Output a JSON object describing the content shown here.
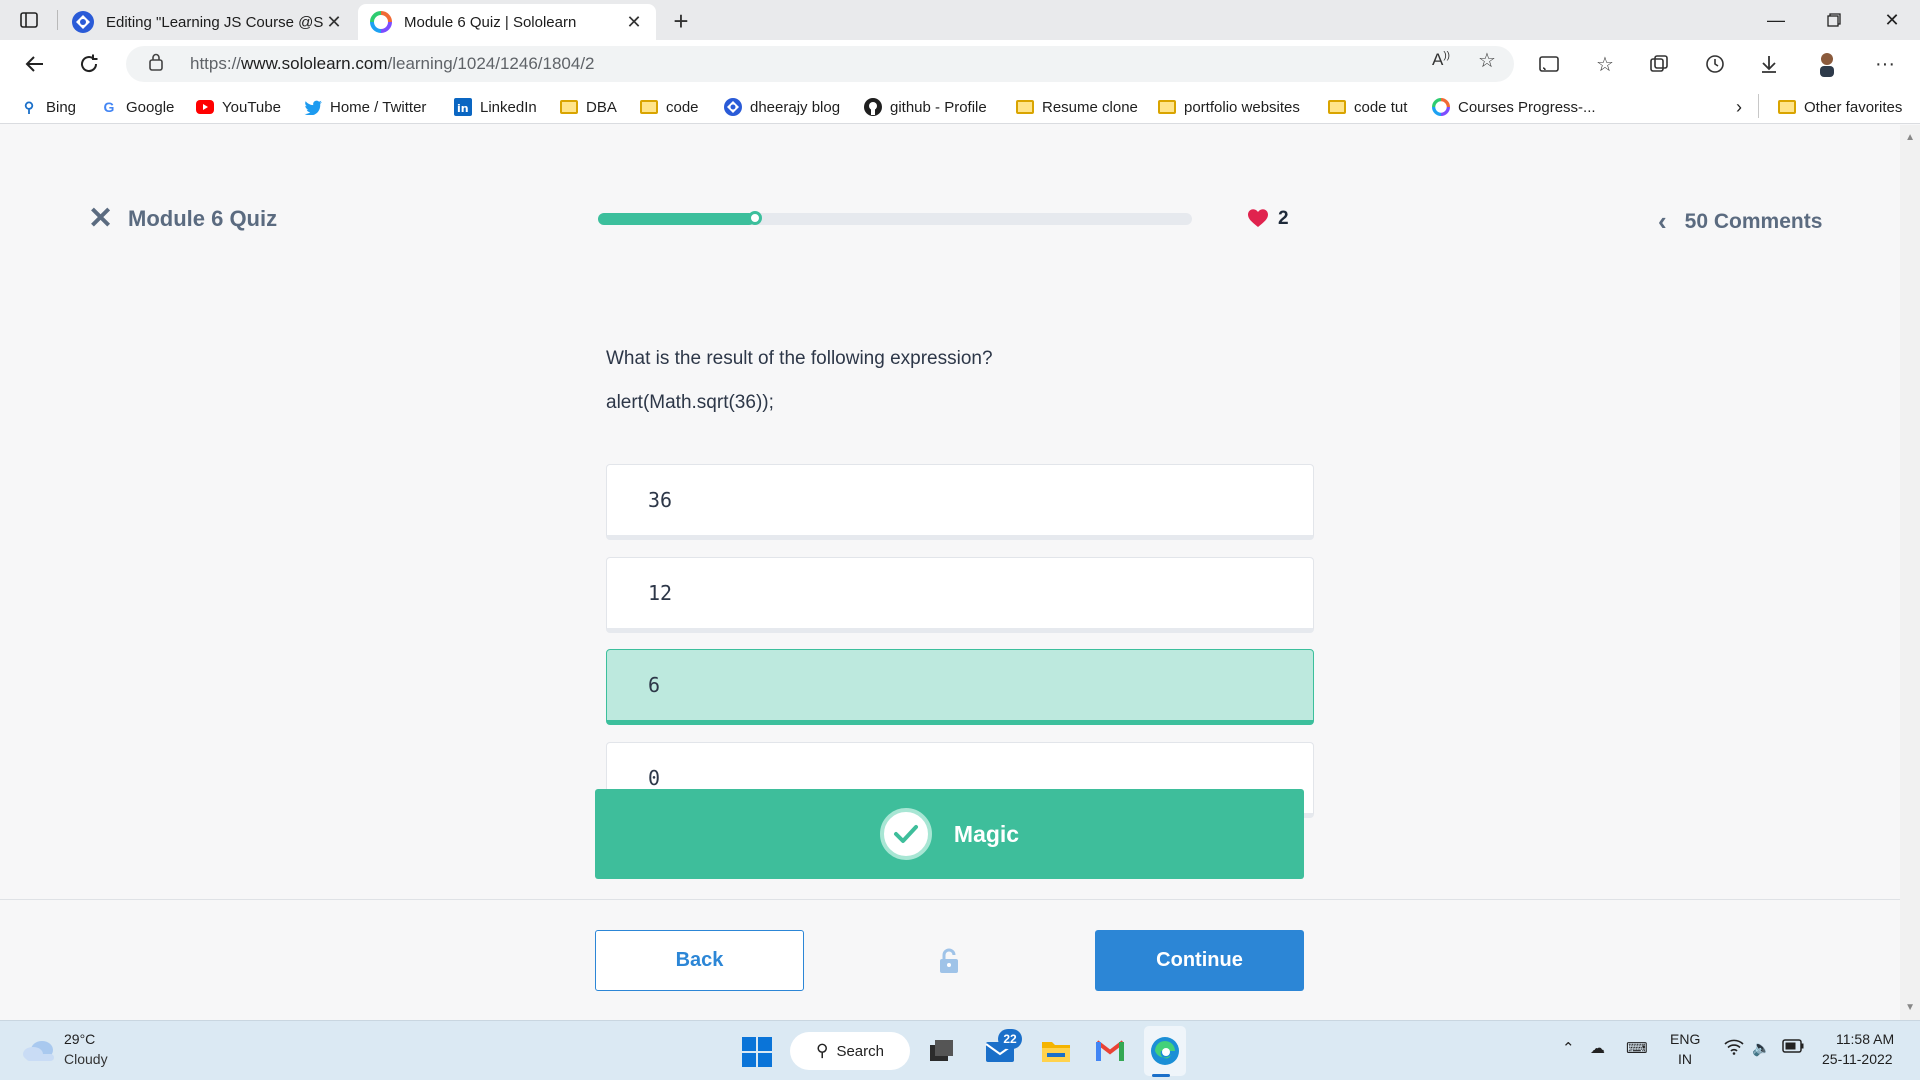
{
  "browser": {
    "tabs": [
      {
        "title": "Editing \"Learning JS Course @Sc",
        "active": false
      },
      {
        "title": "Module 6 Quiz | Sololearn",
        "active": true
      }
    ],
    "url_prefix": "https://",
    "url_host": "www.sololearn.com",
    "url_path": "/learning/1024/1246/1804/2",
    "favorites": [
      {
        "label": "Bing",
        "icon": "search-icon"
      },
      {
        "label": "Google",
        "icon": "google-icon"
      },
      {
        "label": "YouTube",
        "icon": "youtube-icon"
      },
      {
        "label": "Home / Twitter",
        "icon": "twitter-icon"
      },
      {
        "label": "LinkedIn",
        "icon": "linkedin-icon"
      },
      {
        "label": "DBA",
        "icon": "folder-icon"
      },
      {
        "label": "code",
        "icon": "folder-icon"
      },
      {
        "label": "dheerajy blog",
        "icon": "blog-icon"
      },
      {
        "label": "github - Profile",
        "icon": "github-icon"
      },
      {
        "label": "Resume clone",
        "icon": "folder-icon"
      },
      {
        "label": "portfolio websites",
        "icon": "folder-icon"
      },
      {
        "label": "code tut",
        "icon": "folder-icon"
      },
      {
        "label": "Courses Progress-...",
        "icon": "sololearn-icon"
      }
    ],
    "other_favorites": "Other favorites"
  },
  "quiz": {
    "title": "Module 6 Quiz",
    "progress_fraction": 0.265,
    "lives": "2",
    "comments": "50 Comments",
    "question": "What is the result of the following expression?",
    "code": "alert(Math.sqrt(36));",
    "options": [
      "36",
      "12",
      "6",
      "0"
    ],
    "selected_index": 2,
    "result_text": "Magic",
    "back_label": "Back",
    "continue_label": "Continue"
  },
  "colors": {
    "accent_green": "#3ebe9b",
    "primary_blue": "#2c86d6",
    "heart_red": "#e0234e"
  },
  "taskbar": {
    "temperature": "29°C",
    "weather": "Cloudy",
    "search_label": "Search",
    "mail_badge": "22",
    "lang_top": "ENG",
    "lang_bottom": "IN",
    "time": "11:58 AM",
    "date": "25-11-2022"
  }
}
